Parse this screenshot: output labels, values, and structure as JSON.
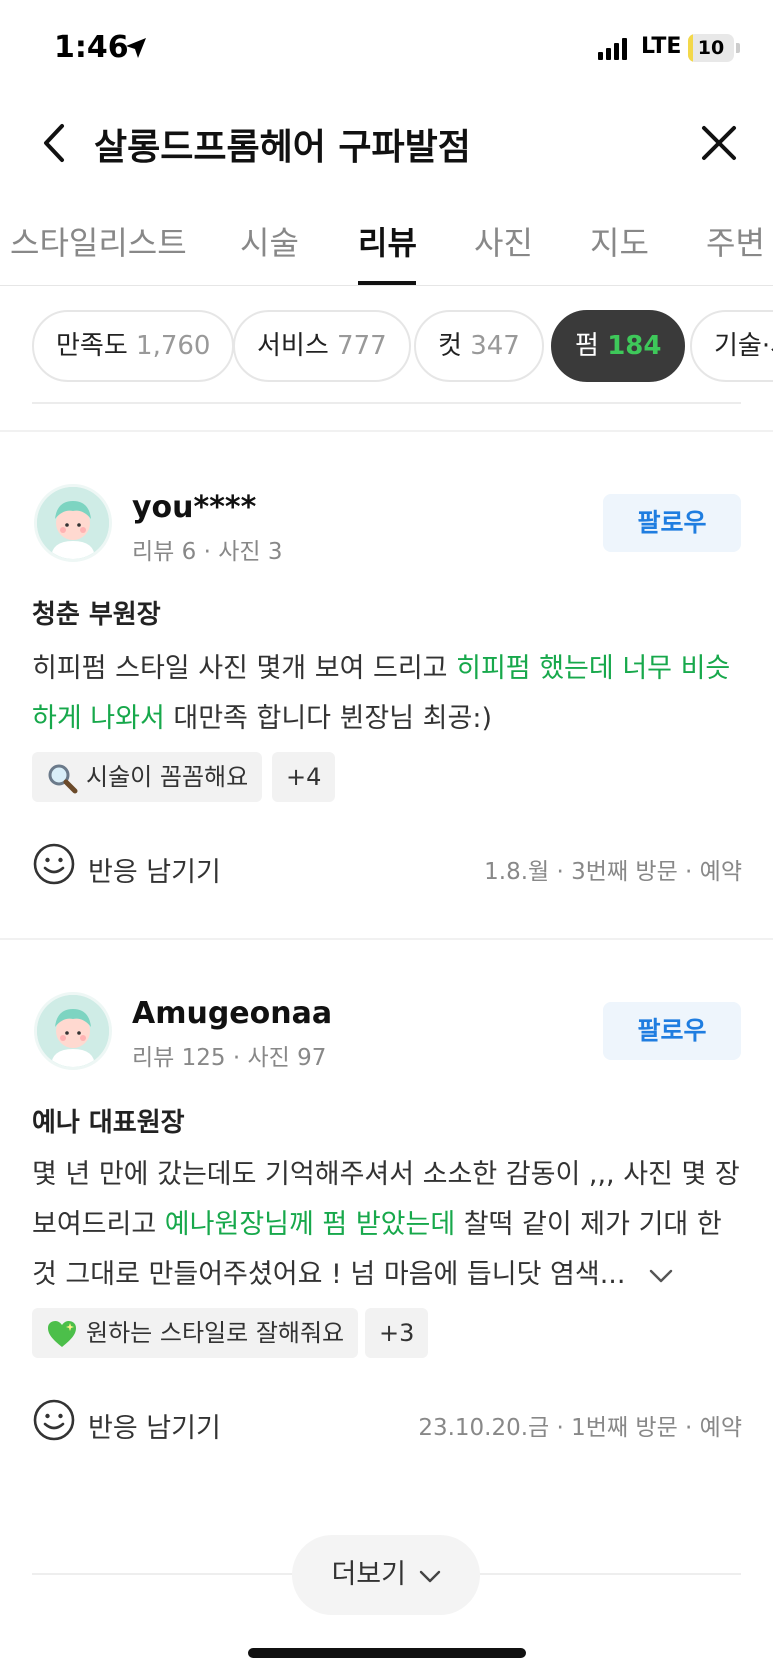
{
  "status_bar": {
    "time": "1:46",
    "network": "LTE",
    "battery_level": "10",
    "battery_percent": 10
  },
  "header": {
    "title": "살롱드프롬헤어 구파발점"
  },
  "tabs": [
    "스타일리스트",
    "시술",
    "리뷰",
    "사진",
    "지도",
    "주변"
  ],
  "active_tab": "리뷰",
  "filter_chips": [
    {
      "label": "만족도",
      "count": "1,760"
    },
    {
      "label": "서비스",
      "count": "777"
    },
    {
      "label": "컷",
      "count": "347"
    },
    {
      "label": "펌",
      "count": "184",
      "active": true
    },
    {
      "label": "기술·시",
      "count": ""
    }
  ],
  "reviews": [
    {
      "username": "you****",
      "stats": "리뷰 6 · 사진 3",
      "follow_label": "팔로우",
      "stylist": "청춘 부원장",
      "text_before": "히피펌 스타일 사진 몇개 보여 드리고 ",
      "text_highlight": "히피펌 했는데 너무 비슷하게 나와서",
      "text_after": " 대만족 합니다 뷘장님 최공:)",
      "tag_icon": "magnifier-icon",
      "tag_label": "시술이 꼼꼼해요",
      "tag_more": "+4",
      "react_label": "반응 남기기",
      "meta": "1.8.월 · 3번째 방문 · 예약"
    },
    {
      "username": "Amugeonaa",
      "stats": "리뷰 125 · 사진 97",
      "follow_label": "팔로우",
      "stylist": "예나 대표원장",
      "text_before": "몇 년 만에 갔는데도 기억해주셔서 소소한 감동이 ,,, 사진 몇 장 보여드리고 ",
      "text_highlight": "예나원장님께 펌 받았는데",
      "text_after": " 찰떡 같이 제가 기대 한 것 그대로 만들어주셨어요 ! 넘 마음에 듭니닷 염색...",
      "tag_icon": "green-heart-icon",
      "tag_label": "원하는 스타일로 잘해줘요",
      "tag_more": "+3",
      "react_label": "반응 남기기",
      "meta": "23.10.20.금 · 1번째 방문 · 예약"
    }
  ],
  "more_button": {
    "label": "더보기"
  },
  "colors": {
    "highlight": "#17a84b",
    "follow": "#1f7de0",
    "active_chip": "#3a3a3a",
    "active_count": "#3ec85a"
  }
}
